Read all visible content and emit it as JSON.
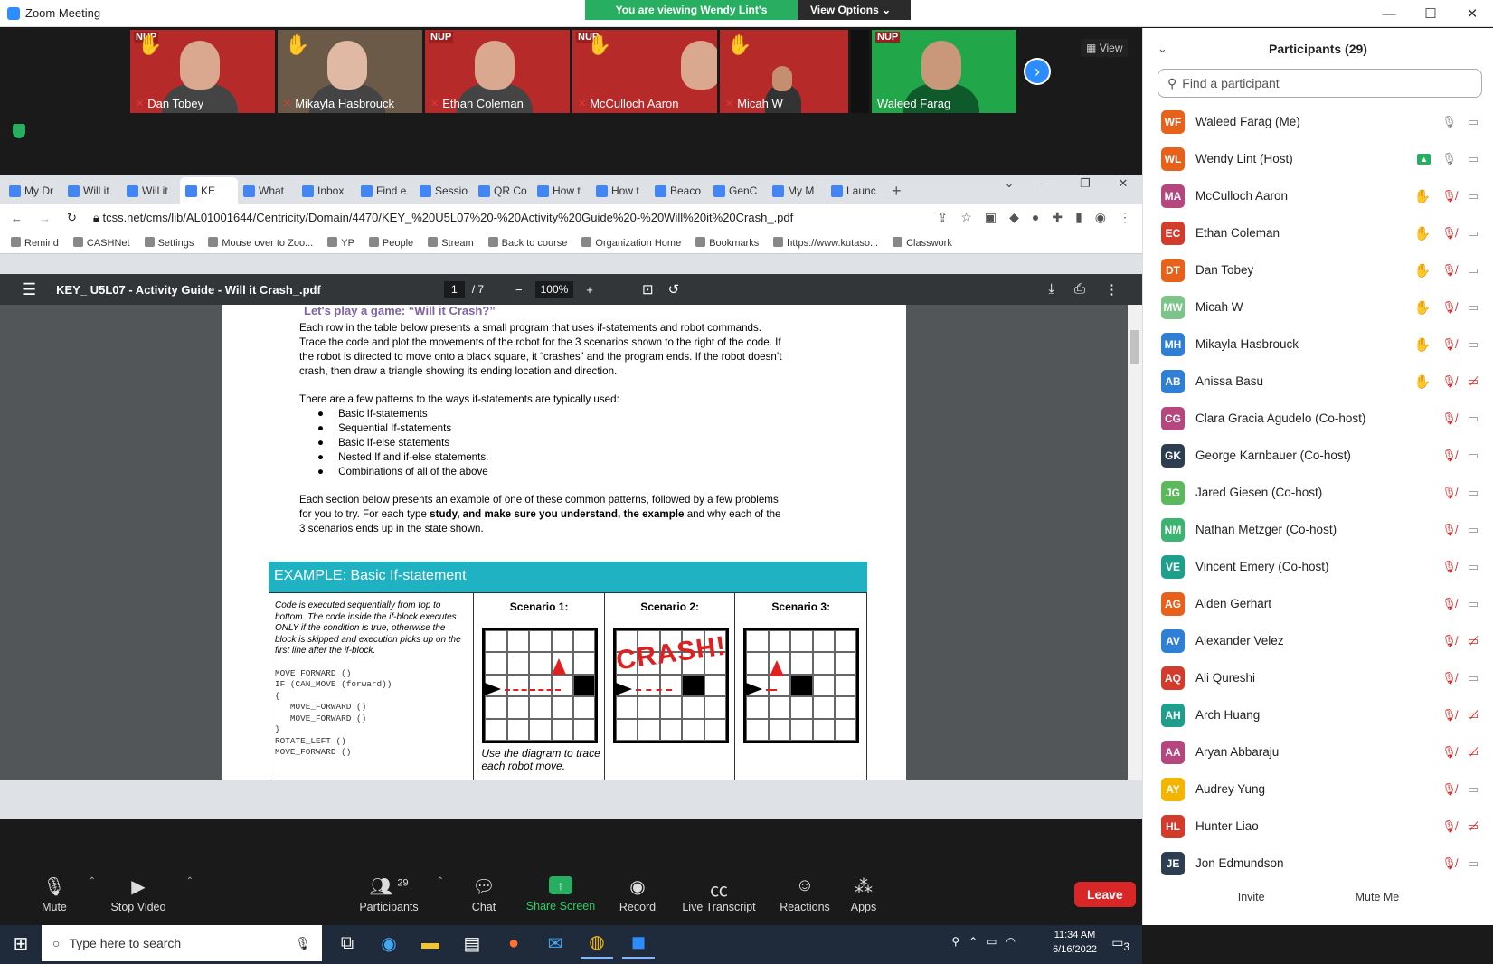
{
  "window": {
    "title": "Zoom Meeting"
  },
  "banner": {
    "viewing": "You are viewing Wendy Lint's screen",
    "view_options": "View Options"
  },
  "gallery": {
    "view_label": "View",
    "tiles": [
      {
        "name": "Dan Tobey"
      },
      {
        "name": "Mikayla Hasbrouck"
      },
      {
        "name": "Ethan Coleman"
      },
      {
        "name": "McCulloch Aaron"
      },
      {
        "name": "Micah W"
      },
      {
        "name": "Waleed Farag"
      }
    ]
  },
  "browser": {
    "tabs": [
      "My Dr",
      "Will it",
      "Will it",
      "KE",
      "What",
      "Inbox",
      "Find e",
      "Sessio",
      "QR Co",
      "How t",
      "How t",
      "Beaco",
      "GenC",
      "My M",
      "Launc"
    ],
    "url": "tcss.net/cms/lib/AL01001644/Centricity/Domain/4470/KEY_%20U5L07%20-%20Activity%20Guide%20-%20Will%20it%20Crash_.pdf",
    "bookmarks": [
      "Remind",
      "CASHNet",
      "Settings",
      "Mouse over to Zoo...",
      "YP",
      "People",
      "Stream",
      "Back to course",
      "Organization Home",
      "Bookmarks",
      "https://www.kutaso...",
      "Classwork"
    ]
  },
  "pdf": {
    "title": "KEY_ U5L07 - Activity Guide - Will it Crash_.pdf",
    "page_current": "1",
    "page_total": "/ 7",
    "zoom": "100%"
  },
  "doc": {
    "heading": "Let's play a game: “Will it Crash?”",
    "para1": [
      "Each row in the table below presents a small program that uses if-statements and robot commands.",
      "Trace the code and plot the movements of the robot for the 3 scenarios shown to the right of the code. If",
      "the robot is directed to move onto a black square, it “crashes” and the program ends.  If the robot doesn’t",
      "crash, then draw a triangle showing its ending location and direction."
    ],
    "para2": "There are a few patterns to the ways if-statements are typically used:",
    "bullets": [
      "Basic If-statements",
      "Sequential If-statements",
      "Basic If-else statements",
      "Nested If and if-else statements.",
      "Combinations of all of the above"
    ],
    "para3": [
      "Each section below presents an example of one of these common patterns, followed by a few problems",
      "for you to try.   For each type",
      "study, and make sure you understand, the example",
      "and why each of the",
      "3 scenarios ends up in the state shown."
    ],
    "example_title": "EXAMPLE: Basic If-statement",
    "code_desc": "Code is executed sequentially from top to bottom. The code inside the if-block executes ONLY if the condition is true, otherwise the block is skipped and execution picks up on the first line after the if-block.",
    "code": "MOVE_FORWARD ()\nIF (CAN_MOVE (forward))\n{\n   MOVE_FORWARD ()\n   MOVE_FORWARD ()\n}\nROTATE_LEFT ()\nMOVE_FORWARD ()",
    "scenarios": [
      "Scenario 1:",
      "Scenario 2:",
      "Scenario 3:"
    ],
    "crash": "CRASH!",
    "caption": "Use the diagram to trace each robot move."
  },
  "taskbar": {
    "search_placeholder": "Type here to search",
    "time": "11:34 AM",
    "date": "6/16/2022",
    "notif_count": "3"
  },
  "toolbar": {
    "mute": "Mute",
    "stop_video": "Stop Video",
    "participants": "Participants",
    "participants_count": "29",
    "chat": "Chat",
    "share": "Share Screen",
    "record": "Record",
    "transcript": "Live Transcript",
    "reactions": "Reactions",
    "apps": "Apps",
    "leave": "Leave"
  },
  "panel": {
    "title": "Participants (29)",
    "search_placeholder": "Find a participant",
    "participants": [
      {
        "initials": "WF",
        "name": "Waleed Farag (Me)",
        "color": "#e8611a",
        "hand": "",
        "mic": "on",
        "cam": "on",
        "share": false
      },
      {
        "initials": "WL",
        "name": "Wendy Lint (Host)",
        "color": "#e8611a",
        "hand": "",
        "mic": "on",
        "cam": "on",
        "share": true
      },
      {
        "initials": "MA",
        "name": "McCulloch Aaron",
        "color": "#b5467e",
        "hand": "raised",
        "mic": "off",
        "cam": "on",
        "share": false
      },
      {
        "initials": "EC",
        "name": "Ethan Coleman",
        "color": "#d23c2c",
        "hand": "faint",
        "mic": "off",
        "cam": "on",
        "share": false
      },
      {
        "initials": "DT",
        "name": "Dan Tobey",
        "color": "#e8611a",
        "hand": "faint",
        "mic": "off",
        "cam": "on",
        "share": false
      },
      {
        "initials": "MW",
        "name": "Micah W",
        "color": "#7cc48a",
        "hand": "raised",
        "mic": "off",
        "cam": "on",
        "share": false
      },
      {
        "initials": "MH",
        "name": "Mikayla Hasbrouck",
        "color": "#2f7fd6",
        "hand": "raised",
        "mic": "off",
        "cam": "on",
        "share": false
      },
      {
        "initials": "AB",
        "name": "Anissa Basu",
        "color": "#2f7fd6",
        "hand": "raised",
        "mic": "off",
        "cam": "off",
        "share": false
      },
      {
        "initials": "CG",
        "name": "Clara Gracia Agudelo (Co-host)",
        "color": "#b5467e",
        "hand": "",
        "mic": "off",
        "cam": "on",
        "share": false
      },
      {
        "initials": "GK",
        "name": "George Karnbauer (Co-host)",
        "color": "#2c3e50",
        "hand": "",
        "mic": "off",
        "cam": "on",
        "share": false
      },
      {
        "initials": "JG",
        "name": "Jared Giesen (Co-host)",
        "color": "#5cb85c",
        "hand": "",
        "mic": "off",
        "cam": "on",
        "share": false
      },
      {
        "initials": "NM",
        "name": "Nathan Metzger (Co-host)",
        "color": "#3cb371",
        "hand": "",
        "mic": "off",
        "cam": "on",
        "share": false
      },
      {
        "initials": "VE",
        "name": "Vincent Emery (Co-host)",
        "color": "#1f9e8c",
        "hand": "",
        "mic": "off",
        "cam": "on",
        "share": false
      },
      {
        "initials": "AG",
        "name": "Aiden Gerhart",
        "color": "#e8611a",
        "hand": "",
        "mic": "off",
        "cam": "on",
        "share": false
      },
      {
        "initials": "AV",
        "name": "Alexander Velez",
        "color": "#2f7fd6",
        "hand": "",
        "mic": "off",
        "cam": "off",
        "share": false
      },
      {
        "initials": "AQ",
        "name": "Ali Qureshi",
        "color": "#d23c2c",
        "hand": "",
        "mic": "off",
        "cam": "on",
        "share": false
      },
      {
        "initials": "AH",
        "name": "Arch Huang",
        "color": "#1f9e8c",
        "hand": "",
        "mic": "off",
        "cam": "off",
        "share": false
      },
      {
        "initials": "AA",
        "name": "Aryan Abbaraju",
        "color": "#b5467e",
        "hand": "",
        "mic": "off",
        "cam": "off",
        "share": false
      },
      {
        "initials": "AY",
        "name": "Audrey Yung",
        "color": "#f4b400",
        "hand": "",
        "mic": "off",
        "cam": "on",
        "share": false
      },
      {
        "initials": "HL",
        "name": "Hunter Liao",
        "color": "#d23c2c",
        "hand": "",
        "mic": "off",
        "cam": "off",
        "share": false
      },
      {
        "initials": "JE",
        "name": "Jon Edmundson",
        "color": "#2c3e50",
        "hand": "",
        "mic": "off",
        "cam": "on",
        "share": false
      }
    ],
    "invite": "Invite",
    "mute_me": "Mute Me"
  }
}
